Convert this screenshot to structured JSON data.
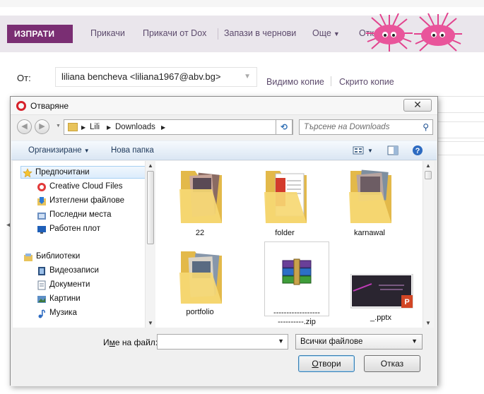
{
  "webmail": {
    "toolbar": {
      "send_label": "ИЗПРАТИ",
      "links": [
        "Прикачи",
        "Прикачи от Dox",
        "Запази в чернови",
        "Още",
        "Откажи"
      ]
    },
    "from": {
      "label": "От:",
      "value": "liliana bencheva <liliana1967@abv.bg>"
    },
    "cc_label": "Видимо копие",
    "bcc_label": "Скрито копие"
  },
  "dialog": {
    "title": "Отваряне",
    "close_glyph": "✕",
    "breadcrumb": [
      "Lili",
      "Downloads"
    ],
    "search_placeholder": "Търсене на Downloads",
    "commands": {
      "organize": "Организиране",
      "new_folder": "Нова папка"
    },
    "tree": {
      "favorites_header": "Предпочитани",
      "favorites": [
        "Creative Cloud Files",
        "Изтеглени файлове",
        "Последни места",
        "Работен плот"
      ],
      "libraries_header": "Библиотеки",
      "libraries": [
        "Видеозаписи",
        "Документи",
        "Картини",
        "Музика"
      ]
    },
    "files": [
      {
        "name": "22",
        "type": "folder"
      },
      {
        "name": "folder",
        "type": "folder"
      },
      {
        "name": "karnawal",
        "type": "folder"
      },
      {
        "name": "portfolio",
        "type": "folder"
      },
      {
        "name": "------------------\n----------.zip",
        "type": "zip"
      },
      {
        "name": "_.pptx",
        "type": "pptx"
      }
    ],
    "filename_label_pre": "И",
    "filename_label_ul": "м",
    "filename_label_post": "е на файл:",
    "filename_value": "",
    "filter_value": "Всички файлове",
    "open_btn_ul": "О",
    "open_btn_rest": "твори",
    "cancel_btn": "Отказ"
  },
  "colors": {
    "brand": "#7a2e73",
    "toolbar_bg": "#eae6ec",
    "link": "#5c4a6c",
    "folder": "#f4d26b"
  }
}
